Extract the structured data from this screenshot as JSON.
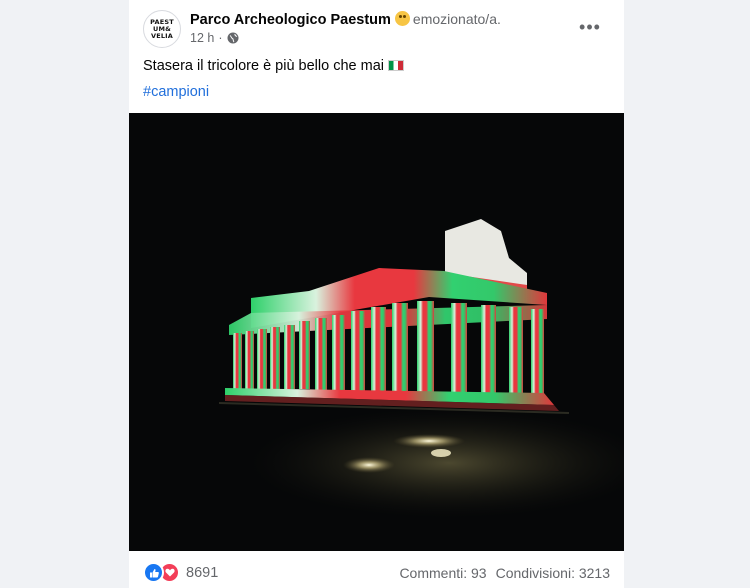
{
  "post": {
    "author": "Parco Archeologico Paestum",
    "feeling": "emozionato/a.",
    "feeling_icon": "grinning-squinting-face-emoji",
    "timestamp": "12 h",
    "privacy_icon": "globe-icon",
    "text": "Stasera il tricolore è più bello che mai",
    "flag_icon": "italy-flag-emoji",
    "hashtag": "#campioni",
    "avatar_lines": [
      "PAEST",
      "UM&",
      "VELIA"
    ]
  },
  "reactions": {
    "icons": [
      "like-icon",
      "love-icon"
    ],
    "count": "8691"
  },
  "stats": {
    "comments": "Commenti: 93",
    "shares": "Condivisioni: 3213"
  },
  "colors": {
    "link_blue": "#216fdb",
    "like_blue": "#1877f2",
    "love_red": "#f33e58",
    "temple_green": "#2ed06a",
    "temple_white": "#f2f2f2",
    "temple_red": "#e8383f"
  }
}
